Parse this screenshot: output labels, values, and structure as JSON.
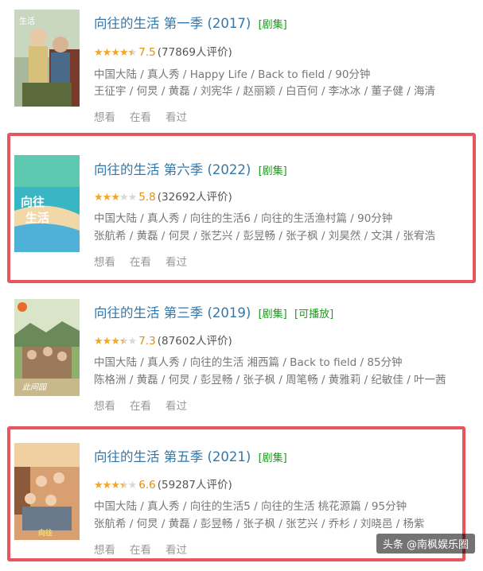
{
  "items": [
    {
      "title": "向往的生活 第一季 (2017)",
      "badges": [
        "[剧集]"
      ],
      "stars": [
        "on",
        "on",
        "on",
        "on",
        "half"
      ],
      "score": "7.5",
      "votes": "(77869人评价)",
      "meta": "中国大陆 / 真人秀 / Happy Life / Back to field / 90分钟",
      "cast": "王征宇 / 何炅 / 黄磊 / 刘宪华 / 赵丽颖 / 白百何 / 李冰冰 / 董子健 / 海清",
      "actions": [
        "想看",
        "在看",
        "看过"
      ],
      "poster_text": "生活",
      "highlighted": false
    },
    {
      "title": "向往的生活 第六季 (2022)",
      "badges": [
        "[剧集]"
      ],
      "stars": [
        "on",
        "on",
        "on",
        "off",
        "off"
      ],
      "score": "5.8",
      "votes": "(32692人评价)",
      "meta": "中国大陆 / 真人秀 / 向往的生活6 / 向往的生活渔村篇 / 90分钟",
      "cast": "张航希 / 黄磊 / 何炅 / 张艺兴 / 彭昱畅 / 张子枫 / 刘昊然 / 文淇 / 张宥浩",
      "actions": [
        "想看",
        "在看",
        "看过"
      ],
      "poster_text": "向往的生活",
      "highlighted": true
    },
    {
      "title": "向往的生活 第三季 (2019)",
      "badges": [
        "[剧集]",
        "[可播放]"
      ],
      "stars": [
        "on",
        "on",
        "on",
        "half",
        "off"
      ],
      "score": "7.3",
      "votes": "(87602人评价)",
      "meta": "中国大陆 / 真人秀 / 向往的生活 湘西篇 / Back to field / 85分钟",
      "cast": "陈格洲 / 黄磊 / 何炅 / 彭昱畅 / 张子枫 / 周笔畅 / 黄雅莉 / 纪敏佳 / 叶一茜",
      "actions": [
        "想看",
        "在看",
        "看过"
      ],
      "poster_text": "向往的生活",
      "highlighted": false
    },
    {
      "title": "向往的生活 第五季 (2021)",
      "badges": [
        "[剧集]"
      ],
      "stars": [
        "on",
        "on",
        "on",
        "half",
        "off"
      ],
      "score": "6.6",
      "votes": "(59287人评价)",
      "meta": "中国大陆 / 真人秀 / 向往的生活5 / 向往的生活 桃花源篇 / 95分钟",
      "cast": "张航希 / 何炅 / 黄磊 / 彭昱畅 / 张子枫 / 张艺兴 / 乔杉 / 刘晓邑 / 杨紫",
      "actions": [
        "想看",
        "在看",
        "看过"
      ],
      "poster_text": "向往的生活",
      "highlighted": true
    }
  ],
  "watermark": "头条 @南枫娱乐圈",
  "colors": {
    "title": "#3377aa",
    "badge": "#1a9b1a",
    "star": "#f5a623",
    "highlight": "#e8555e"
  }
}
